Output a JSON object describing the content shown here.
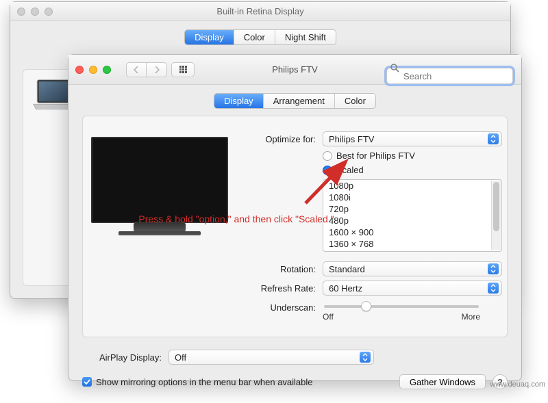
{
  "back_window": {
    "title": "Built-in Retina Display",
    "tabs": [
      "Display",
      "Color",
      "Night Shift"
    ],
    "active_tab_index": 0
  },
  "front_window": {
    "title": "Philips FTV",
    "search_placeholder": "Search",
    "tabs": [
      "Display",
      "Arrangement",
      "Color"
    ],
    "active_tab_index": 0,
    "optimize_for_label": "Optimize for:",
    "optimize_for_value": "Philips FTV",
    "radio_options": {
      "best_label": "Best for Philips FTV",
      "scaled_label": "Scaled",
      "selected": "scaled"
    },
    "resolutions": [
      "1080p",
      "1080i",
      "720p",
      "480p",
      "1600 × 900",
      "1360 × 768"
    ],
    "rotation_label": "Rotation:",
    "rotation_value": "Standard",
    "refresh_label": "Refresh Rate:",
    "refresh_value": "60 Hertz",
    "underscan_label": "Underscan:",
    "underscan_min": "Off",
    "underscan_max": "More",
    "underscan_pos": 0.25,
    "airplay_label": "AirPlay Display:",
    "airplay_value": "Off",
    "mirroring_checkbox_checked": true,
    "mirroring_label": "Show mirroring options in the menu bar when available",
    "gather_button": "Gather Windows",
    "help_symbol": "?"
  },
  "annotation_text": "Press & hold \"option,\" and then click \"Scaled.\"",
  "watermark": "www.deuaq.com"
}
